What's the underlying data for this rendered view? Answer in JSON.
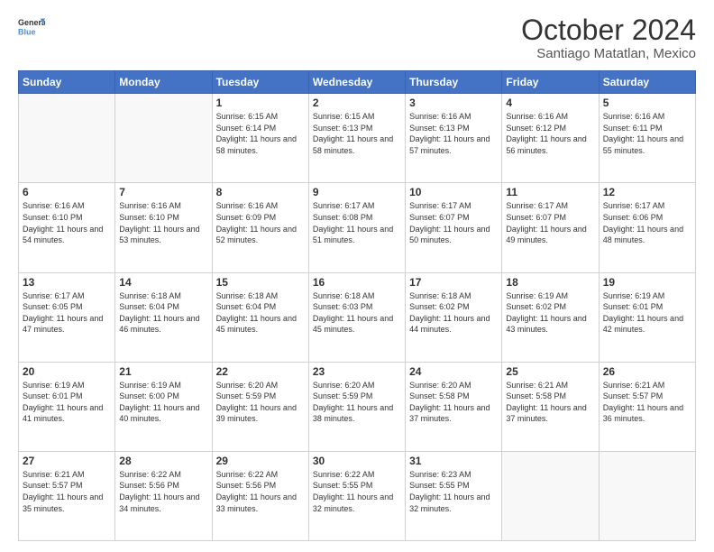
{
  "header": {
    "logo_line1": "General",
    "logo_line2": "Blue",
    "title": "October 2024",
    "subtitle": "Santiago Matatlan, Mexico"
  },
  "days_of_week": [
    "Sunday",
    "Monday",
    "Tuesday",
    "Wednesday",
    "Thursday",
    "Friday",
    "Saturday"
  ],
  "weeks": [
    [
      {
        "day": "",
        "empty": true
      },
      {
        "day": "",
        "empty": true
      },
      {
        "day": "1",
        "sunrise": "6:15 AM",
        "sunset": "6:14 PM",
        "daylight": "11 hours and 58 minutes."
      },
      {
        "day": "2",
        "sunrise": "6:15 AM",
        "sunset": "6:13 PM",
        "daylight": "11 hours and 58 minutes."
      },
      {
        "day": "3",
        "sunrise": "6:16 AM",
        "sunset": "6:13 PM",
        "daylight": "11 hours and 57 minutes."
      },
      {
        "day": "4",
        "sunrise": "6:16 AM",
        "sunset": "6:12 PM",
        "daylight": "11 hours and 56 minutes."
      },
      {
        "day": "5",
        "sunrise": "6:16 AM",
        "sunset": "6:11 PM",
        "daylight": "11 hours and 55 minutes."
      }
    ],
    [
      {
        "day": "6",
        "sunrise": "6:16 AM",
        "sunset": "6:10 PM",
        "daylight": "11 hours and 54 minutes."
      },
      {
        "day": "7",
        "sunrise": "6:16 AM",
        "sunset": "6:10 PM",
        "daylight": "11 hours and 53 minutes."
      },
      {
        "day": "8",
        "sunrise": "6:16 AM",
        "sunset": "6:09 PM",
        "daylight": "11 hours and 52 minutes."
      },
      {
        "day": "9",
        "sunrise": "6:17 AM",
        "sunset": "6:08 PM",
        "daylight": "11 hours and 51 minutes."
      },
      {
        "day": "10",
        "sunrise": "6:17 AM",
        "sunset": "6:07 PM",
        "daylight": "11 hours and 50 minutes."
      },
      {
        "day": "11",
        "sunrise": "6:17 AM",
        "sunset": "6:07 PM",
        "daylight": "11 hours and 49 minutes."
      },
      {
        "day": "12",
        "sunrise": "6:17 AM",
        "sunset": "6:06 PM",
        "daylight": "11 hours and 48 minutes."
      }
    ],
    [
      {
        "day": "13",
        "sunrise": "6:17 AM",
        "sunset": "6:05 PM",
        "daylight": "11 hours and 47 minutes."
      },
      {
        "day": "14",
        "sunrise": "6:18 AM",
        "sunset": "6:04 PM",
        "daylight": "11 hours and 46 minutes."
      },
      {
        "day": "15",
        "sunrise": "6:18 AM",
        "sunset": "6:04 PM",
        "daylight": "11 hours and 45 minutes."
      },
      {
        "day": "16",
        "sunrise": "6:18 AM",
        "sunset": "6:03 PM",
        "daylight": "11 hours and 45 minutes."
      },
      {
        "day": "17",
        "sunrise": "6:18 AM",
        "sunset": "6:02 PM",
        "daylight": "11 hours and 44 minutes."
      },
      {
        "day": "18",
        "sunrise": "6:19 AM",
        "sunset": "6:02 PM",
        "daylight": "11 hours and 43 minutes."
      },
      {
        "day": "19",
        "sunrise": "6:19 AM",
        "sunset": "6:01 PM",
        "daylight": "11 hours and 42 minutes."
      }
    ],
    [
      {
        "day": "20",
        "sunrise": "6:19 AM",
        "sunset": "6:01 PM",
        "daylight": "11 hours and 41 minutes."
      },
      {
        "day": "21",
        "sunrise": "6:19 AM",
        "sunset": "6:00 PM",
        "daylight": "11 hours and 40 minutes."
      },
      {
        "day": "22",
        "sunrise": "6:20 AM",
        "sunset": "5:59 PM",
        "daylight": "11 hours and 39 minutes."
      },
      {
        "day": "23",
        "sunrise": "6:20 AM",
        "sunset": "5:59 PM",
        "daylight": "11 hours and 38 minutes."
      },
      {
        "day": "24",
        "sunrise": "6:20 AM",
        "sunset": "5:58 PM",
        "daylight": "11 hours and 37 minutes."
      },
      {
        "day": "25",
        "sunrise": "6:21 AM",
        "sunset": "5:58 PM",
        "daylight": "11 hours and 37 minutes."
      },
      {
        "day": "26",
        "sunrise": "6:21 AM",
        "sunset": "5:57 PM",
        "daylight": "11 hours and 36 minutes."
      }
    ],
    [
      {
        "day": "27",
        "sunrise": "6:21 AM",
        "sunset": "5:57 PM",
        "daylight": "11 hours and 35 minutes."
      },
      {
        "day": "28",
        "sunrise": "6:22 AM",
        "sunset": "5:56 PM",
        "daylight": "11 hours and 34 minutes."
      },
      {
        "day": "29",
        "sunrise": "6:22 AM",
        "sunset": "5:56 PM",
        "daylight": "11 hours and 33 minutes."
      },
      {
        "day": "30",
        "sunrise": "6:22 AM",
        "sunset": "5:55 PM",
        "daylight": "11 hours and 32 minutes."
      },
      {
        "day": "31",
        "sunrise": "6:23 AM",
        "sunset": "5:55 PM",
        "daylight": "11 hours and 32 minutes."
      },
      {
        "day": "",
        "empty": true
      },
      {
        "day": "",
        "empty": true
      }
    ]
  ]
}
